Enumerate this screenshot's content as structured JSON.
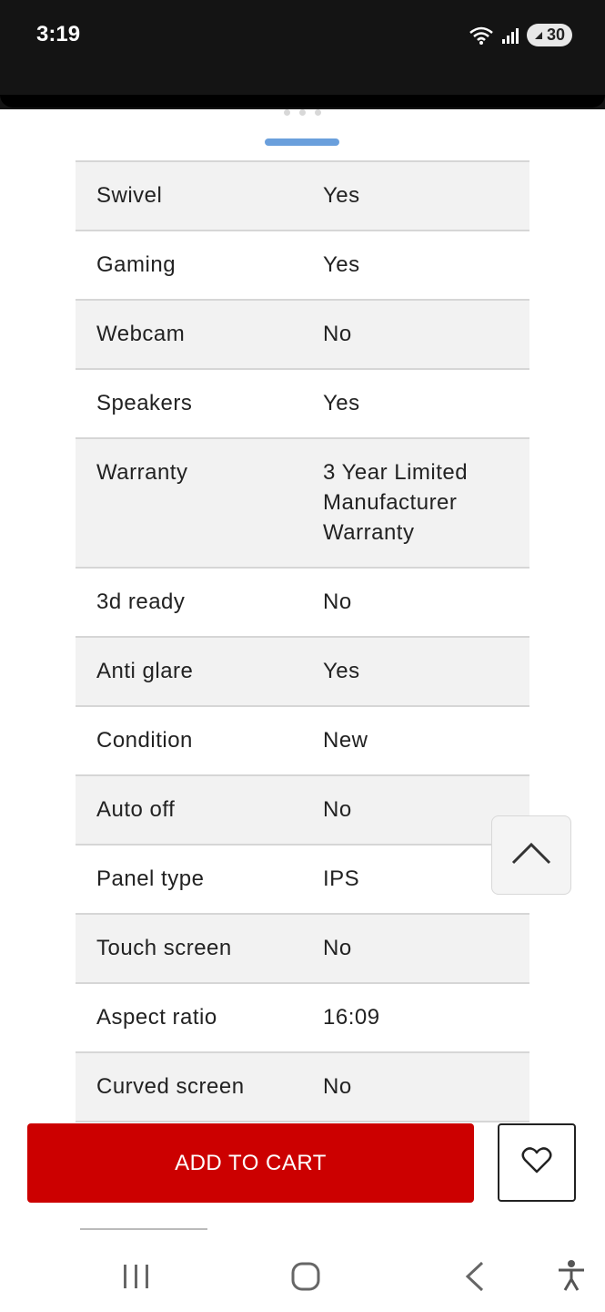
{
  "status": {
    "time": "3:19",
    "battery": "30",
    "icons": [
      "wifi-icon",
      "signal-icon",
      "battery-saver-icon"
    ]
  },
  "specs": [
    {
      "label": "Swivel",
      "value": "Yes"
    },
    {
      "label": "Gaming",
      "value": "Yes"
    },
    {
      "label": "Webcam",
      "value": "No"
    },
    {
      "label": "Speakers",
      "value": "Yes"
    },
    {
      "label": "Warranty",
      "value": "3 Year Limited Manufacturer Warranty"
    },
    {
      "label": "3d ready",
      "value": "No"
    },
    {
      "label": "Anti glare",
      "value": "Yes"
    },
    {
      "label": "Condition",
      "value": "New"
    },
    {
      "label": "Auto off",
      "value": "No"
    },
    {
      "label": "Panel type",
      "value": "IPS"
    },
    {
      "label": "Touch screen",
      "value": "No"
    },
    {
      "label": "Aspect ratio",
      "value": "16:09"
    },
    {
      "label": "Curved screen",
      "value": "No"
    }
  ],
  "actions": {
    "add_to_cart": "ADD TO CART",
    "wishlist_icon": "heart-icon",
    "scroll_top_icon": "chevron-up-icon"
  },
  "colors": {
    "accent": "#cc0000",
    "handle": "#6a9fdc"
  },
  "nav": [
    "recent-apps-icon",
    "home-icon",
    "back-icon",
    "accessibility-icon"
  ]
}
